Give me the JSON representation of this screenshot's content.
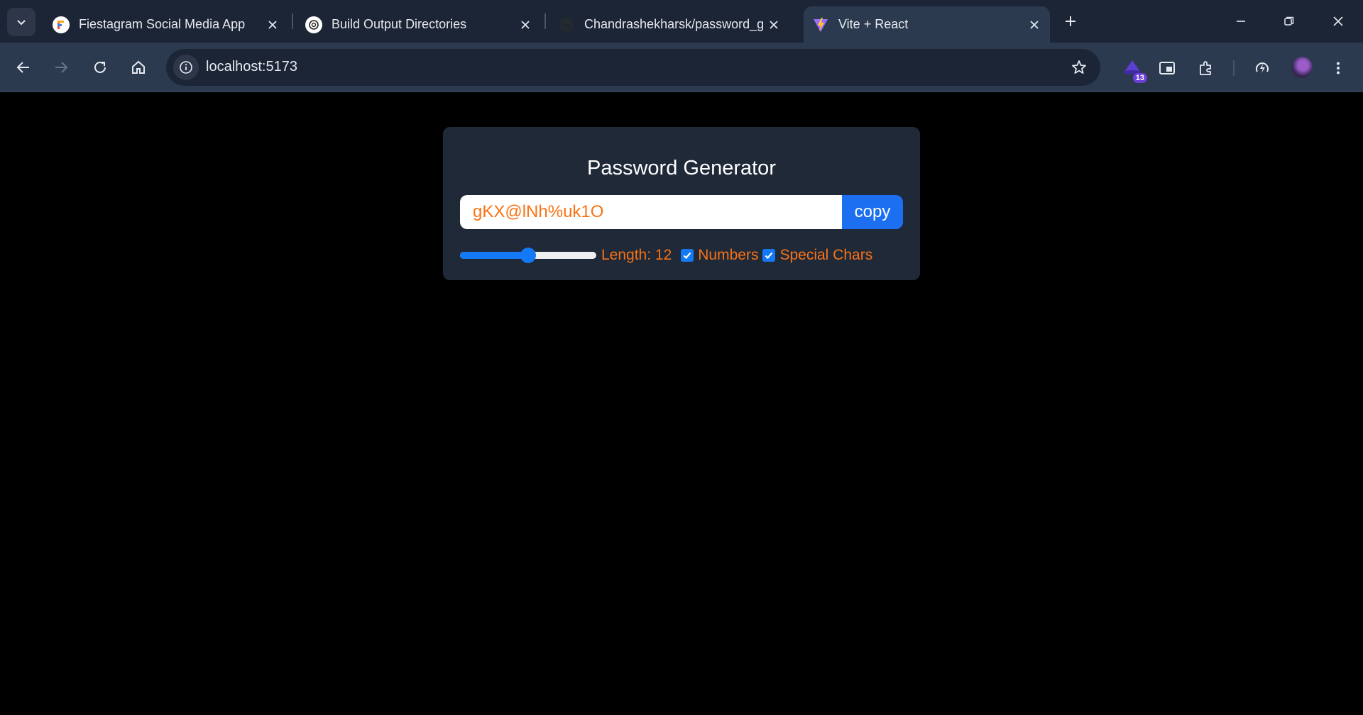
{
  "browser": {
    "tabs": [
      {
        "title": "Fiestagram Social Media App",
        "icon": "fiestagram-favicon",
        "active": false
      },
      {
        "title": "Build Output Directories",
        "icon": "chatgpt-favicon",
        "active": false
      },
      {
        "title": "Chandrashekharsk/password_g",
        "icon": "github-favicon",
        "active": false
      },
      {
        "title": "Vite + React",
        "icon": "vite-favicon",
        "active": true
      }
    ],
    "url": "localhost:5173",
    "extension_badge": "13",
    "colors": {
      "tabstrip": "#1c2535",
      "toolbar": "#2c3a4f",
      "omnibox": "#1c2535"
    }
  },
  "app": {
    "title": "Password Generator",
    "password": "gKX@lNh%uk1O",
    "copy_label": "copy",
    "length_label": "Length: 12",
    "length_value": 12,
    "length_slider_fraction": 0.5,
    "numbers_label": "Numbers",
    "numbers_checked": true,
    "special_label": "Special Chars",
    "special_checked": true,
    "colors": {
      "card": "#1f2937",
      "accent": "#f97316",
      "button": "#1d6ff2",
      "slider": "#1479f4"
    }
  }
}
